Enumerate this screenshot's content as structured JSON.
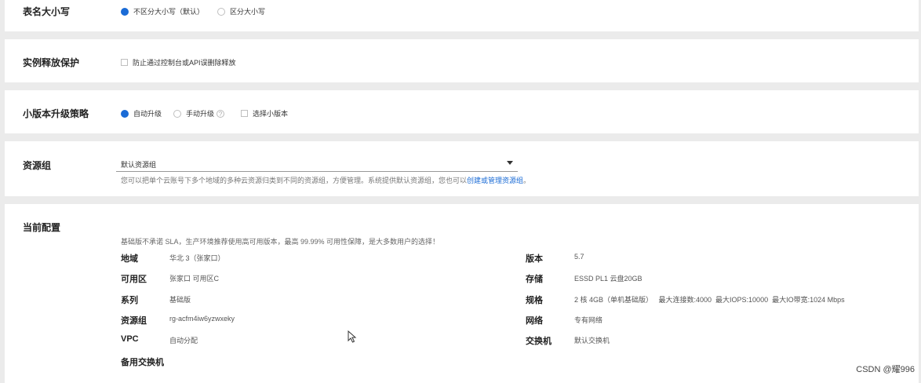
{
  "table_case": {
    "label": "表名大小写",
    "options": [
      {
        "label": "不区分大小写（默认）",
        "selected": true
      },
      {
        "label": "区分大小写",
        "selected": false
      }
    ]
  },
  "release_protection": {
    "label": "实例释放保护",
    "checkbox_label": "防止通过控制台或API误删除释放",
    "checked": false
  },
  "minor_version": {
    "label": "小版本升级策略",
    "options": [
      {
        "label": "自动升级",
        "selected": true
      },
      {
        "label": "手动升级",
        "selected": false
      }
    ],
    "select_version_label": "选择小版本",
    "select_version_checked": false
  },
  "resource_group": {
    "label": "资源组",
    "selected_value": "默认资源组",
    "hint_text": "您可以把单个云账号下多个地域的多种云资源归类到不同的资源组，方便管理。系统提供默认资源组，您也可以",
    "hint_link": "创建或管理资源组",
    "hint_suffix": "。"
  },
  "current_config": {
    "label": "当前配置",
    "notice": "基础版不承诺 SLA，生产环境推荐使用高可用版本，最高 99.99% 可用性保障，是大多数用户的选择！",
    "left": [
      {
        "key": "地域",
        "value": "华北 3（张家口）"
      },
      {
        "key": "可用区",
        "value": "张家口 可用区C"
      },
      {
        "key": "系列",
        "value": "基础版"
      },
      {
        "key": "资源组",
        "value": "rg-acfm4iw6yzwxeky"
      },
      {
        "key": "VPC",
        "value": "自动分配"
      },
      {
        "key": "备用交换机",
        "value": ""
      }
    ],
    "right": [
      {
        "key": "版本",
        "value": "5.7"
      },
      {
        "key": "存储",
        "value": "ESSD PL1 云盘20GB"
      },
      {
        "key": "规格",
        "value": "2 核 4GB（单机基础版）   最大连接数:4000  最大IOPS:10000  最大IO带宽:1024 Mbps"
      },
      {
        "key": "网络",
        "value": "专有网络"
      },
      {
        "key": "交换机",
        "value": "默认交换机"
      }
    ]
  },
  "watermark": "CSDN @耀996",
  "colors": {
    "accent": "#1a6bd6",
    "page_bg": "#ebebeb"
  }
}
